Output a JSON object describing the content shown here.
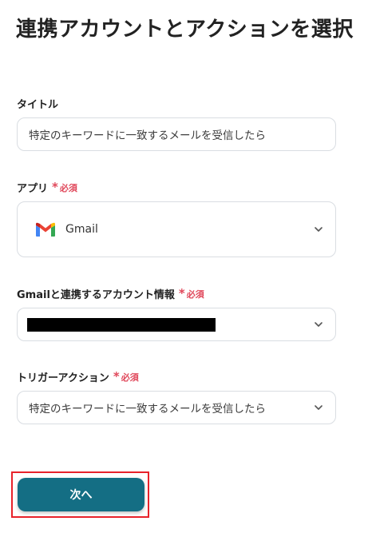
{
  "page": {
    "title": "連携アカウントとアクションを選択"
  },
  "fields": {
    "title": {
      "label": "タイトル",
      "value": "特定のキーワードに一致するメールを受信したら"
    },
    "app": {
      "label": "アプリ",
      "required_star": "*",
      "required_text": "必須",
      "selected": "Gmail",
      "icon": "gmail-logo-icon"
    },
    "account": {
      "label": "Gmailと連携するアカウント情報",
      "required_star": "*",
      "required_text": "必須"
    },
    "trigger": {
      "label": "トリガーアクション",
      "required_star": "*",
      "required_text": "必須",
      "selected": "特定のキーワードに一致するメールを受信したら"
    }
  },
  "actions": {
    "next_label": "次へ"
  },
  "colors": {
    "accent": "#146e84",
    "required": "#e0475a",
    "highlight_border": "#e8222a"
  }
}
